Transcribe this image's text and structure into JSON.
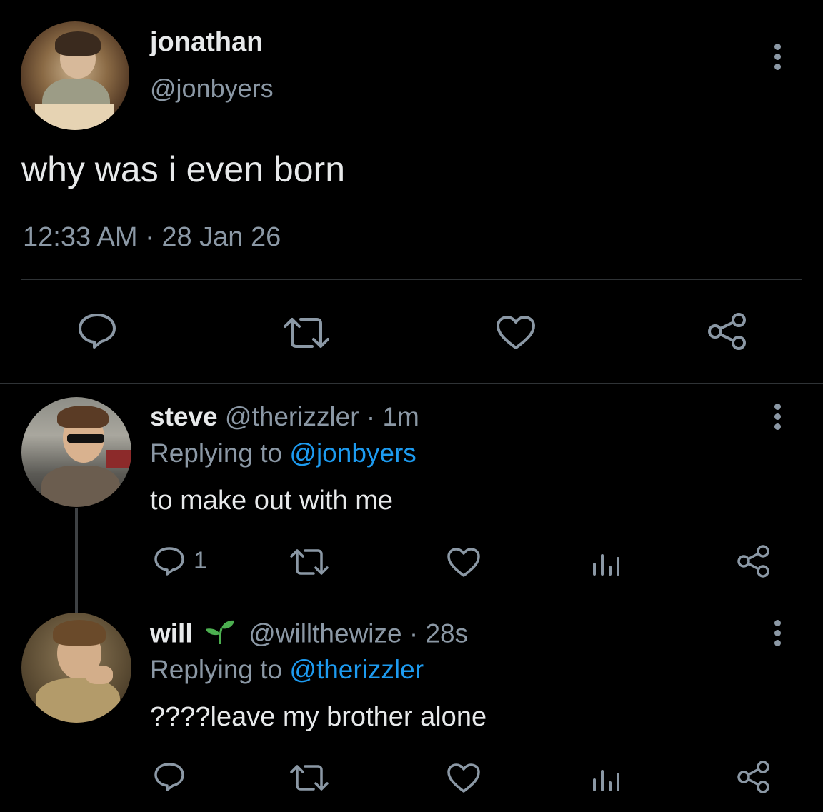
{
  "main_tweet": {
    "display_name": "jonathan",
    "handle": "@jonbyers",
    "text": "why was i even born",
    "timestamp": "12:33 AM · 28 Jan 26",
    "actions": [
      "reply-icon",
      "retweet-icon",
      "like-icon",
      "share-icon"
    ]
  },
  "replies": [
    {
      "display_name": "steve",
      "handle": "@therizzler",
      "time": "· 1m",
      "replying_prefix": "Replying to ",
      "replying_to": "@jonbyers",
      "text": "to make out with me",
      "reply_count": "1"
    },
    {
      "display_name": "will",
      "name_emoji": "seedling-icon",
      "handle": "@willthewize",
      "time": "· 28s",
      "replying_prefix": "Replying to ",
      "replying_to": "@therizzler",
      "text": "????leave my brother alone"
    }
  ],
  "colors": {
    "background": "#000000",
    "text": "#e7e9ea",
    "muted": "#8b98a5",
    "link": "#1d9bf0",
    "divider": "#2f3336",
    "seedling": "#4caf50"
  }
}
